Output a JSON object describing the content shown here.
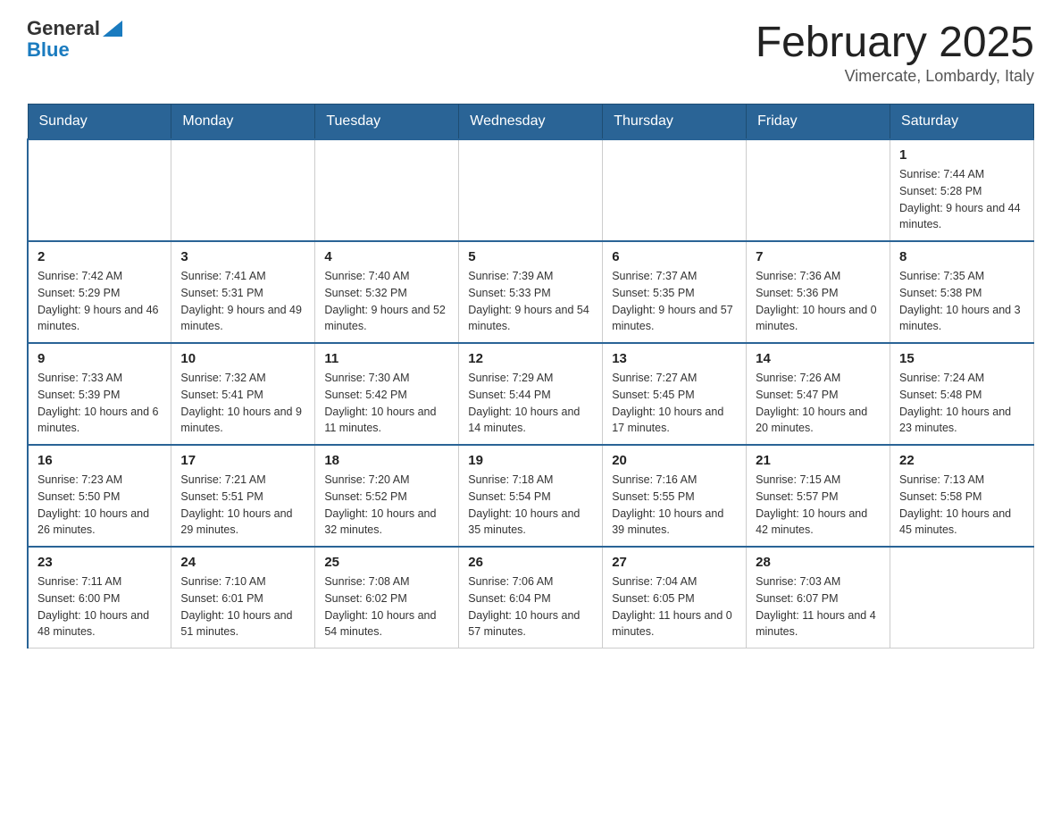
{
  "logo": {
    "general": "General",
    "blue": "Blue"
  },
  "title": "February 2025",
  "location": "Vimercate, Lombardy, Italy",
  "days_of_week": [
    "Sunday",
    "Monday",
    "Tuesday",
    "Wednesday",
    "Thursday",
    "Friday",
    "Saturday"
  ],
  "weeks": [
    [
      {
        "day": "",
        "info": ""
      },
      {
        "day": "",
        "info": ""
      },
      {
        "day": "",
        "info": ""
      },
      {
        "day": "",
        "info": ""
      },
      {
        "day": "",
        "info": ""
      },
      {
        "day": "",
        "info": ""
      },
      {
        "day": "1",
        "info": "Sunrise: 7:44 AM\nSunset: 5:28 PM\nDaylight: 9 hours and 44 minutes."
      }
    ],
    [
      {
        "day": "2",
        "info": "Sunrise: 7:42 AM\nSunset: 5:29 PM\nDaylight: 9 hours and 46 minutes."
      },
      {
        "day": "3",
        "info": "Sunrise: 7:41 AM\nSunset: 5:31 PM\nDaylight: 9 hours and 49 minutes."
      },
      {
        "day": "4",
        "info": "Sunrise: 7:40 AM\nSunset: 5:32 PM\nDaylight: 9 hours and 52 minutes."
      },
      {
        "day": "5",
        "info": "Sunrise: 7:39 AM\nSunset: 5:33 PM\nDaylight: 9 hours and 54 minutes."
      },
      {
        "day": "6",
        "info": "Sunrise: 7:37 AM\nSunset: 5:35 PM\nDaylight: 9 hours and 57 minutes."
      },
      {
        "day": "7",
        "info": "Sunrise: 7:36 AM\nSunset: 5:36 PM\nDaylight: 10 hours and 0 minutes."
      },
      {
        "day": "8",
        "info": "Sunrise: 7:35 AM\nSunset: 5:38 PM\nDaylight: 10 hours and 3 minutes."
      }
    ],
    [
      {
        "day": "9",
        "info": "Sunrise: 7:33 AM\nSunset: 5:39 PM\nDaylight: 10 hours and 6 minutes."
      },
      {
        "day": "10",
        "info": "Sunrise: 7:32 AM\nSunset: 5:41 PM\nDaylight: 10 hours and 9 minutes."
      },
      {
        "day": "11",
        "info": "Sunrise: 7:30 AM\nSunset: 5:42 PM\nDaylight: 10 hours and 11 minutes."
      },
      {
        "day": "12",
        "info": "Sunrise: 7:29 AM\nSunset: 5:44 PM\nDaylight: 10 hours and 14 minutes."
      },
      {
        "day": "13",
        "info": "Sunrise: 7:27 AM\nSunset: 5:45 PM\nDaylight: 10 hours and 17 minutes."
      },
      {
        "day": "14",
        "info": "Sunrise: 7:26 AM\nSunset: 5:47 PM\nDaylight: 10 hours and 20 minutes."
      },
      {
        "day": "15",
        "info": "Sunrise: 7:24 AM\nSunset: 5:48 PM\nDaylight: 10 hours and 23 minutes."
      }
    ],
    [
      {
        "day": "16",
        "info": "Sunrise: 7:23 AM\nSunset: 5:50 PM\nDaylight: 10 hours and 26 minutes."
      },
      {
        "day": "17",
        "info": "Sunrise: 7:21 AM\nSunset: 5:51 PM\nDaylight: 10 hours and 29 minutes."
      },
      {
        "day": "18",
        "info": "Sunrise: 7:20 AM\nSunset: 5:52 PM\nDaylight: 10 hours and 32 minutes."
      },
      {
        "day": "19",
        "info": "Sunrise: 7:18 AM\nSunset: 5:54 PM\nDaylight: 10 hours and 35 minutes."
      },
      {
        "day": "20",
        "info": "Sunrise: 7:16 AM\nSunset: 5:55 PM\nDaylight: 10 hours and 39 minutes."
      },
      {
        "day": "21",
        "info": "Sunrise: 7:15 AM\nSunset: 5:57 PM\nDaylight: 10 hours and 42 minutes."
      },
      {
        "day": "22",
        "info": "Sunrise: 7:13 AM\nSunset: 5:58 PM\nDaylight: 10 hours and 45 minutes."
      }
    ],
    [
      {
        "day": "23",
        "info": "Sunrise: 7:11 AM\nSunset: 6:00 PM\nDaylight: 10 hours and 48 minutes."
      },
      {
        "day": "24",
        "info": "Sunrise: 7:10 AM\nSunset: 6:01 PM\nDaylight: 10 hours and 51 minutes."
      },
      {
        "day": "25",
        "info": "Sunrise: 7:08 AM\nSunset: 6:02 PM\nDaylight: 10 hours and 54 minutes."
      },
      {
        "day": "26",
        "info": "Sunrise: 7:06 AM\nSunset: 6:04 PM\nDaylight: 10 hours and 57 minutes."
      },
      {
        "day": "27",
        "info": "Sunrise: 7:04 AM\nSunset: 6:05 PM\nDaylight: 11 hours and 0 minutes."
      },
      {
        "day": "28",
        "info": "Sunrise: 7:03 AM\nSunset: 6:07 PM\nDaylight: 11 hours and 4 minutes."
      },
      {
        "day": "",
        "info": ""
      }
    ]
  ]
}
